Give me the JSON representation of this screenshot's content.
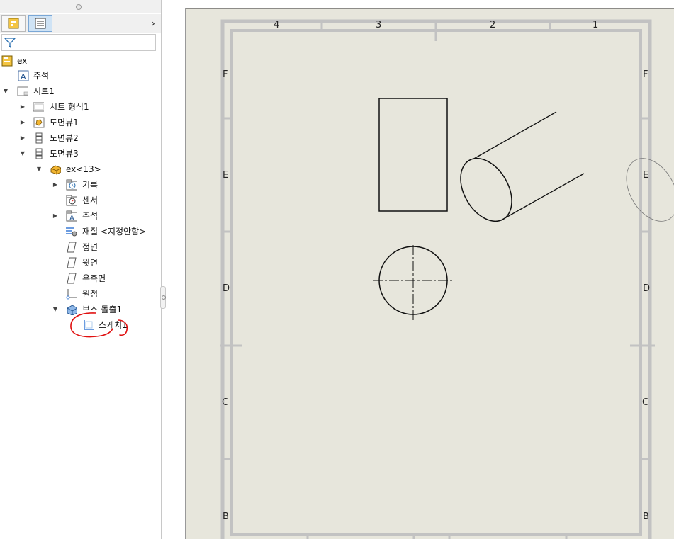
{
  "tree": {
    "root_label": "ex",
    "annotations_label": "주석",
    "sheet_label": "시트1",
    "sheet_format_label": "시트 형식1",
    "view1_label": "도면뷰1",
    "view2_label": "도면뷰2",
    "view3_label": "도면뷰3",
    "part_label": "ex<13>",
    "history_label": "기록",
    "sensors_label": "센서",
    "part_annotations_label": "주석",
    "material_label": "재질 <지정안함>",
    "front_plane_label": "정면",
    "top_plane_label": "윗면",
    "right_plane_label": "우측면",
    "origin_label": "원점",
    "boss_extrude_label": "보스-돌출1",
    "sketch_label": "스케치1"
  },
  "sheet": {
    "col_labels": [
      "4",
      "3",
      "2",
      "1"
    ],
    "row_labels": [
      "F",
      "E",
      "D",
      "C",
      "B"
    ]
  },
  "colors": {
    "sheet_bg": "#e7e6dc",
    "border_gray": "#c2c2c2",
    "markup_red": "#e01010",
    "selection_blue": "#3a7bd5"
  }
}
